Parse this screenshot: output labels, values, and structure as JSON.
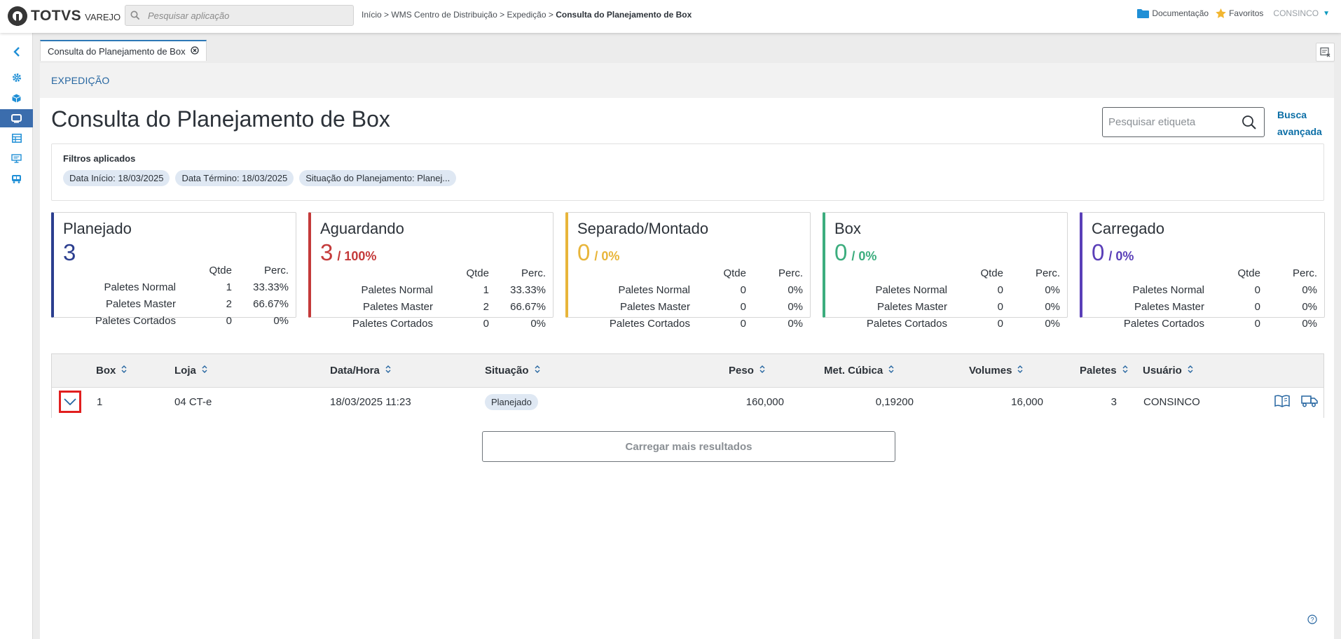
{
  "header": {
    "brand": "TOTVS",
    "brand_sub": "VAREJO",
    "search_placeholder": "Pesquisar aplicação",
    "breadcrumb": [
      "Início",
      "WMS Centro de Distribuição",
      "Expedição",
      "Consulta do Planejamento de Box"
    ],
    "breadcrumb_sep": ">",
    "docs_label": "Documentação",
    "favorites_label": "Favoritos",
    "user": "CONSINCO"
  },
  "sidebar": {
    "items": [
      "chevron-left-icon",
      "gear-icon",
      "box-icon",
      "monitor-icon",
      "table-icon",
      "presentation-icon",
      "truck-icon"
    ],
    "active_index": 3
  },
  "tab": {
    "label": "Consulta do Planejamento de Box"
  },
  "page": {
    "section": "EXPEDIÇÃO",
    "title": "Consulta do Planejamento de Box",
    "label_search_placeholder": "Pesquisar etiqueta",
    "advanced_search": "Busca avançada"
  },
  "filters": {
    "title": "Filtros aplicados",
    "chips": [
      "Data Início: 18/03/2025",
      "Data Término: 18/03/2025",
      "Situação do Planejamento: Planej..."
    ]
  },
  "cards": [
    {
      "title": "Planejado",
      "count": "3",
      "percent": "",
      "color": "#2b3e8f",
      "hdr_qtde": "Qtde",
      "hdr_perc": "Perc.",
      "rows": [
        {
          "label": "Paletes Normal",
          "qtde": "1",
          "perc": "33.33%"
        },
        {
          "label": "Paletes Master",
          "qtde": "2",
          "perc": "66.67%"
        },
        {
          "label": "Paletes Cortados",
          "qtde": "0",
          "perc": "0%"
        }
      ]
    },
    {
      "title": "Aguardando",
      "count": "3",
      "percent": "/ 100%",
      "color": "#c43a3a",
      "hdr_qtde": "Qtde",
      "hdr_perc": "Perc.",
      "rows": [
        {
          "label": "Paletes Normal",
          "qtde": "1",
          "perc": "33.33%"
        },
        {
          "label": "Paletes Master",
          "qtde": "2",
          "perc": "66.67%"
        },
        {
          "label": "Paletes Cortados",
          "qtde": "0",
          "perc": "0%"
        }
      ]
    },
    {
      "title": "Separado/Montado",
      "count": "0",
      "percent": "/ 0%",
      "color": "#e8b53a",
      "hdr_qtde": "Qtde",
      "hdr_perc": "Perc.",
      "rows": [
        {
          "label": "Paletes Normal",
          "qtde": "0",
          "perc": "0%"
        },
        {
          "label": "Paletes Master",
          "qtde": "0",
          "perc": "0%"
        },
        {
          "label": "Paletes Cortados",
          "qtde": "0",
          "perc": "0%"
        }
      ]
    },
    {
      "title": "Box",
      "count": "0",
      "percent": "/ 0%",
      "color": "#3cad7e",
      "hdr_qtde": "Qtde",
      "hdr_perc": "Perc.",
      "rows": [
        {
          "label": "Paletes Normal",
          "qtde": "0",
          "perc": "0%"
        },
        {
          "label": "Paletes Master",
          "qtde": "0",
          "perc": "0%"
        },
        {
          "label": "Paletes Cortados",
          "qtde": "0",
          "perc": "0%"
        }
      ]
    },
    {
      "title": "Carregado",
      "count": "0",
      "percent": "/ 0%",
      "color": "#5a3fb8",
      "hdr_qtde": "Qtde",
      "hdr_perc": "Perc.",
      "rows": [
        {
          "label": "Paletes Normal",
          "qtde": "0",
          "perc": "0%"
        },
        {
          "label": "Paletes Master",
          "qtde": "0",
          "perc": "0%"
        },
        {
          "label": "Paletes Cortados",
          "qtde": "0",
          "perc": "0%"
        }
      ]
    }
  ],
  "grid": {
    "columns": [
      "Box",
      "Loja",
      "Data/Hora",
      "Situação",
      "Peso",
      "Met. Cúbica",
      "Volumes",
      "Paletes",
      "Usuário"
    ],
    "rows": [
      {
        "box": "1",
        "loja": "04 CT-e",
        "datahora": "18/03/2025 11:23",
        "situacao": "Planejado",
        "peso": "160,000",
        "met_cubica": "0,19200",
        "volumes": "16,000",
        "paletes": "3",
        "usuario": "CONSINCO"
      }
    ]
  },
  "load_more": "Carregar mais resultados",
  "colors": {
    "primary": "#2565a0",
    "accent": "#0c9abe",
    "active_sidebar": "#3b6dad",
    "highlight": "#e11f1f"
  }
}
